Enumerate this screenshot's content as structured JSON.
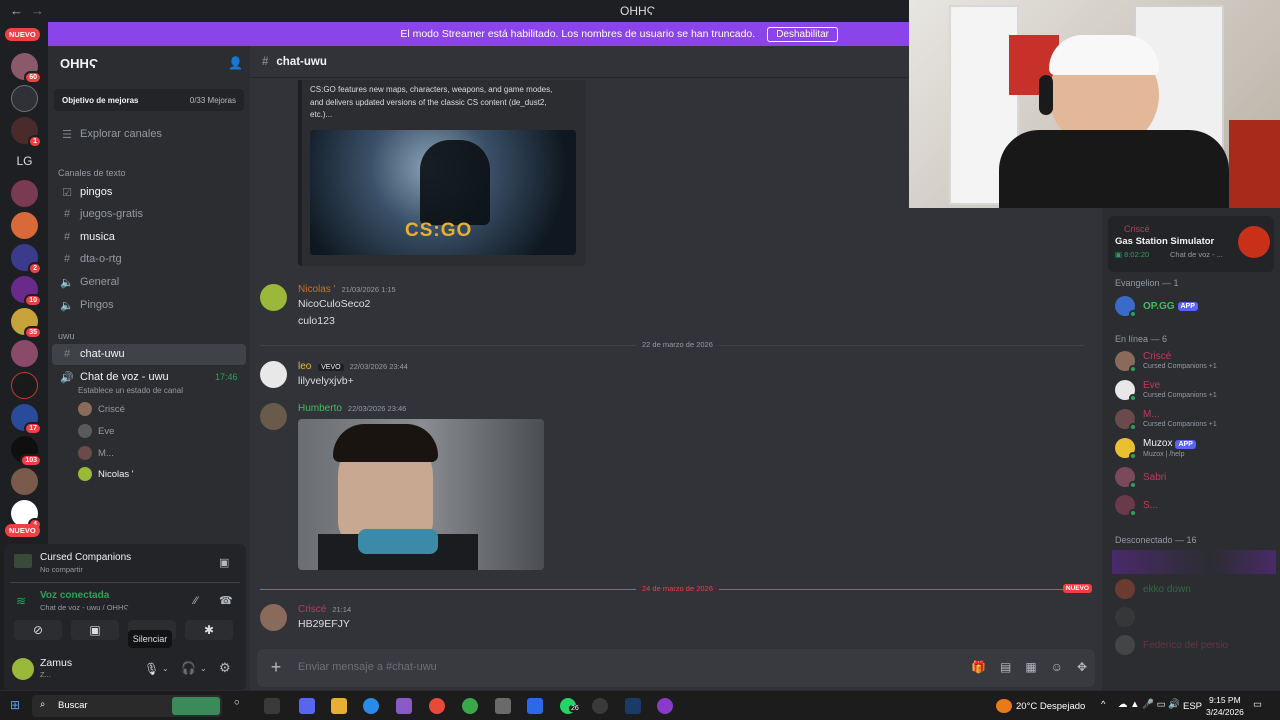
{
  "window": {
    "title": "OHНϚ"
  },
  "banner": {
    "text": "El modo Streamer está habilitado. Los nombres de usuario se han truncado.",
    "button": "Deshabilitar"
  },
  "rail": {
    "top_badge": "NUEVO",
    "bottom_badge": "NUEVO",
    "label": "LG",
    "badges": [
      "60",
      "1",
      "2",
      "10",
      "35",
      "17",
      "103",
      "4"
    ]
  },
  "sidebar": {
    "server_name": "OHНϚ",
    "goal_label": "Objetivo de mejoras",
    "goal_value": "0/33 Mejoras",
    "explore": "Explorar canales",
    "cat_text": "Canales de texto",
    "channels": [
      "pingos",
      "juegos-gratis",
      "musica",
      "dta-o-rtg",
      "General",
      "Pingos"
    ],
    "cat_uwu": "uwu",
    "selected": "chat-uwu",
    "voice_channel": "Chat de voz - uwu",
    "voice_time": "17:46",
    "voice_status": "Establece un estado de canal",
    "voice_users": [
      "Criscé",
      "Eve",
      "M...",
      "Nicolas '"
    ]
  },
  "panel": {
    "activity_title": "Cursed Companions",
    "activity_sub": "No compartir",
    "voice_status": "Voz conectada",
    "voice_sub": "Chat de voz - uwu / OHНϚ",
    "tooltip": "Silenciar",
    "user_name": "Zamus",
    "user_status": "Z..."
  },
  "chat": {
    "channel": "chat-uwu",
    "embed_text_1": "CS:GO features new maps, characters, weapons, and game modes,",
    "embed_text_2": "and delivers updated versions of the classic CS content (de_dust2,",
    "embed_text_3": "etc.)...",
    "embed_logo": "CS:GO",
    "m1": {
      "name": "Nicolas '",
      "time": "21/03/2026 1:15",
      "lines": [
        "NicoCuloSeco2",
        "culo123"
      ]
    },
    "date1": "22 de marzo de 2026",
    "m2": {
      "name": "leo",
      "tag": "VEVO",
      "time": "22/03/2026 23:44",
      "line": "lilyvelyxjvb+"
    },
    "m3": {
      "name": "Humberto",
      "time": "22/03/2026 23:46"
    },
    "date2": "24 de marzo de 2026",
    "new_tag": "NUEVO",
    "m4": {
      "name": "Criscé",
      "time": "21:14",
      "line": "HB29EFJY"
    },
    "placeholder": "Enviar mensaje a #chat-uwu"
  },
  "members": {
    "activity_user": "Criscé",
    "activity_game": "Gas Station Simulator",
    "activity_time": "8:02:20",
    "activity_voice": "Chat de voz - ...",
    "evangelion_head": "Evangelion — 1",
    "opgg": "OP.GG",
    "app_tag": "APP",
    "online_head": "En línea — 6",
    "online": [
      {
        "name": "Criscé",
        "sub": "Cursed Companions +1"
      },
      {
        "name": "Eve",
        "sub": "Cursed Companions +1"
      },
      {
        "name": "M...",
        "sub": "Cursed Companions +1"
      },
      {
        "name": "Muzox",
        "sub": "Muzox | /help"
      },
      {
        "name": "Sabri",
        "sub": ""
      },
      {
        "name": "S...",
        "sub": ""
      }
    ],
    "offline_head": "Desconectado — 16",
    "offline": [
      "ekko down",
      "Federico del persio"
    ]
  },
  "taskbar": {
    "search": "Buscar",
    "weather": "20°C  Despejado",
    "lang": "ESP",
    "time": "9:15 PM",
    "date": "3/24/2026",
    "whatsapp_badge": "26"
  },
  "colors": {
    "accent": "#5865f2",
    "banner": "#8b44ea",
    "online": "#23a55a",
    "danger": "#f23f43"
  }
}
